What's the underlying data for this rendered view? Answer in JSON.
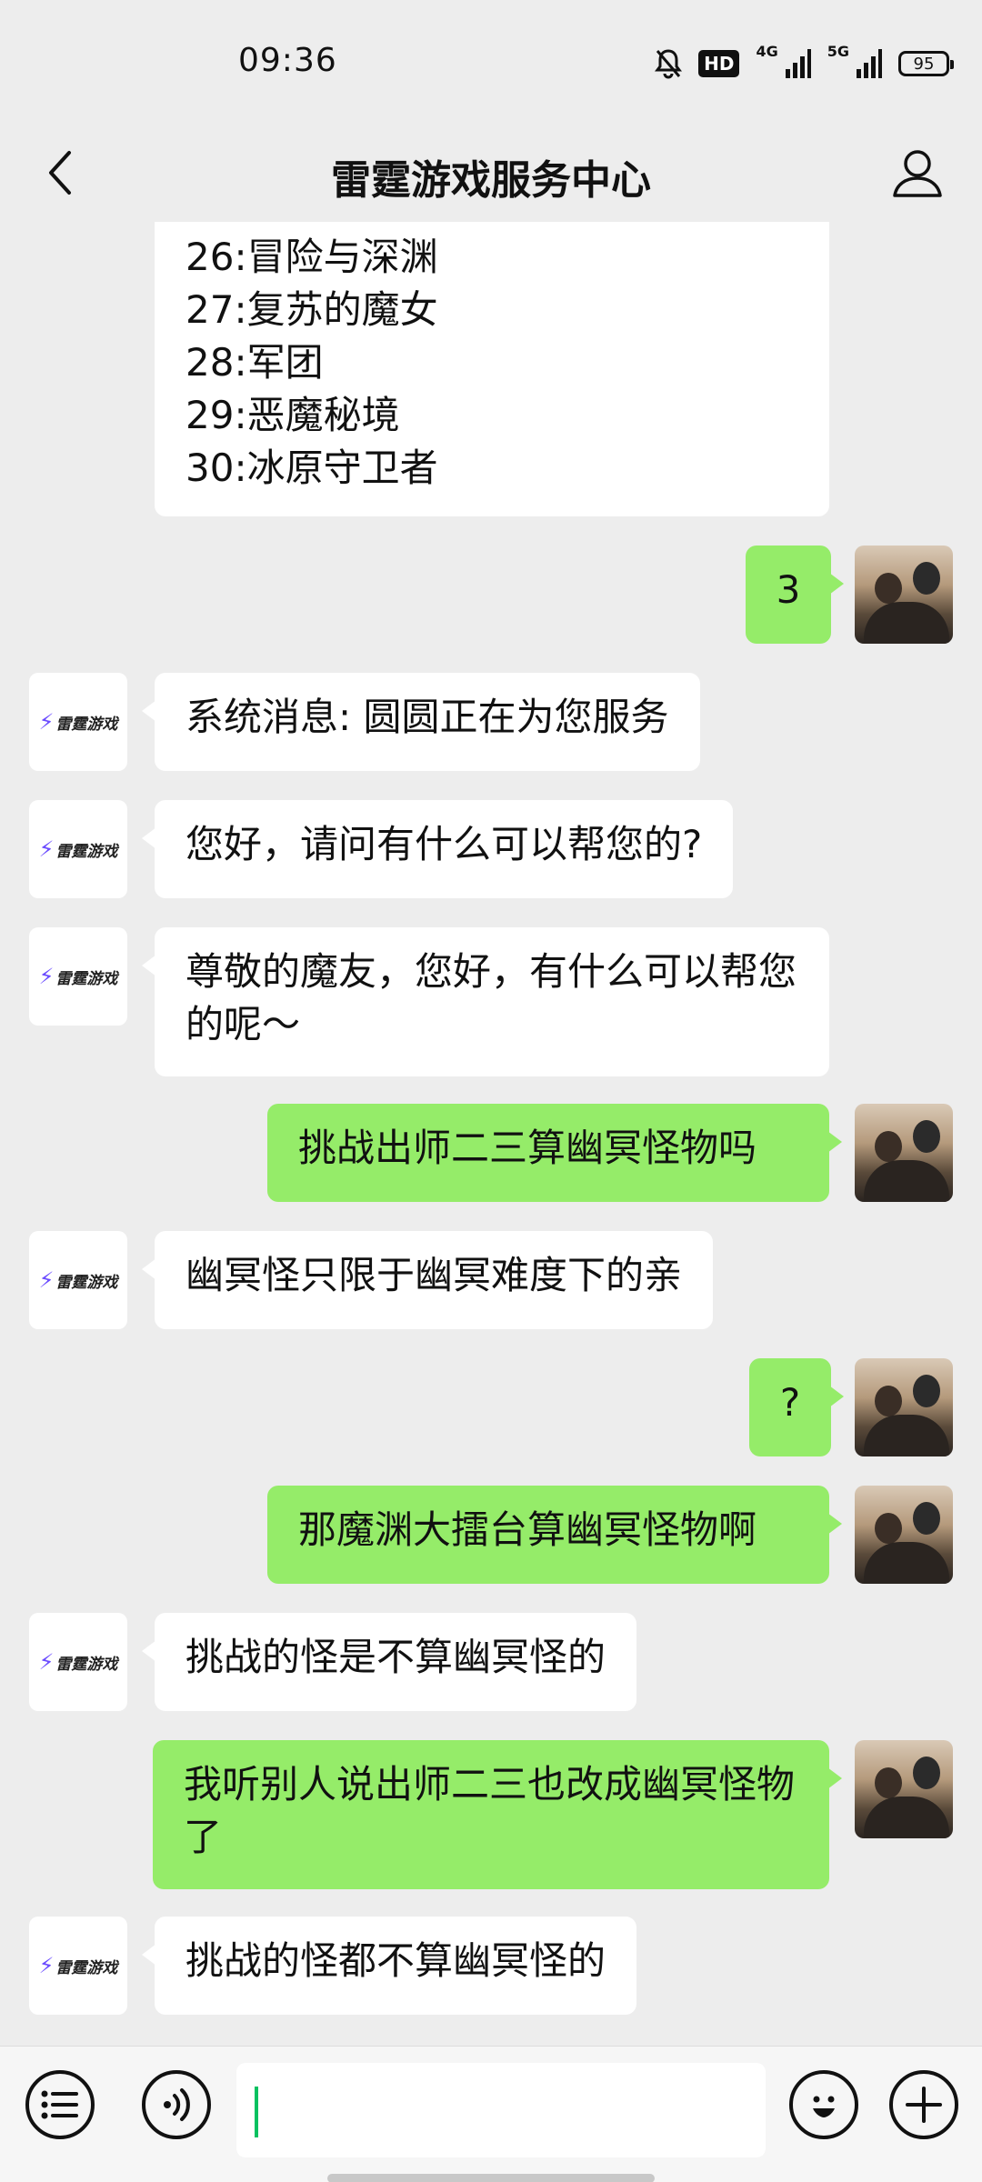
{
  "status_bar": {
    "time": "09:36",
    "hd_label": "HD",
    "network_1": "4G",
    "network_2": "5G",
    "battery": "95"
  },
  "header": {
    "title": "雷霆游戏服务中心",
    "back_icon": "chevron-left-icon",
    "profile_icon": "person-icon"
  },
  "bot": {
    "avatar_label": "雷霆游戏"
  },
  "messages": [
    {
      "from": "bot",
      "type": "list",
      "lines": [
        "26:冒险与深渊",
        "27:复苏的魔女",
        "28:军团",
        "29:恶魔秘境",
        "30:冰原守卫者"
      ]
    },
    {
      "from": "user",
      "text": "3"
    },
    {
      "from": "bot",
      "text": "系统消息: 圆圆正在为您服务"
    },
    {
      "from": "bot",
      "text": "您好，请问有什么可以帮您的?"
    },
    {
      "from": "bot",
      "text": "尊敬的魔友，您好，有什么可以帮您的呢～"
    },
    {
      "from": "user",
      "text": "挑战出师二三算幽冥怪物吗"
    },
    {
      "from": "bot",
      "text": "幽冥怪只限于幽冥难度下的亲"
    },
    {
      "from": "user",
      "text": "?"
    },
    {
      "from": "user",
      "text": "那魔渊大擂台算幽冥怪物啊"
    },
    {
      "from": "bot",
      "text": "挑战的怪是不算幽冥怪的"
    },
    {
      "from": "user",
      "text": "我听别人说出师二三也改成幽冥怪物了"
    },
    {
      "from": "bot",
      "text": "挑战的怪都不算幽冥怪的"
    }
  ],
  "input_bar": {
    "menu_icon": "list-menu-icon",
    "voice_icon": "voice-icon",
    "emoji_icon": "emoji-icon",
    "plus_icon": "plus-icon",
    "input_value": ""
  },
  "colors": {
    "outgoing_bubble": "#95ec69",
    "incoming_bubble": "#ffffff",
    "background": "#ededed"
  }
}
